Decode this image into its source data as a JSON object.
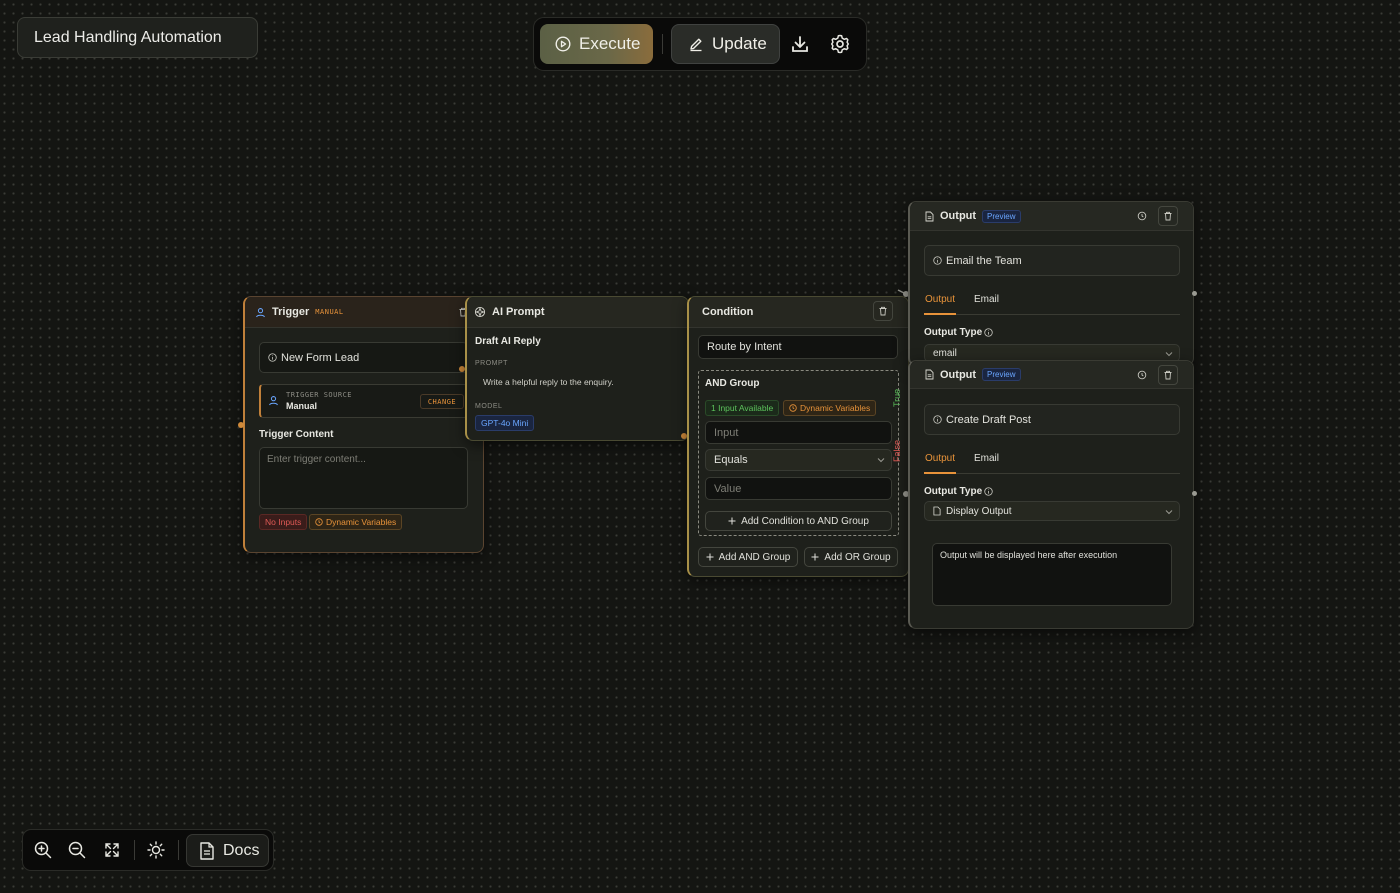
{
  "workflow": {
    "title": "Lead Handling Automation"
  },
  "toolbar": {
    "execute_label": "Execute",
    "update_label": "Update",
    "download_icon": "download-icon",
    "settings_icon": "gear-icon"
  },
  "trigger_node": {
    "title": "Trigger",
    "mode_badge": "MANUAL",
    "name": "New Form Lead",
    "source_label": "TRIGGER SOURCE",
    "source_value": "Manual",
    "change_label": "CHANGE",
    "content_label": "Trigger Content",
    "content_placeholder": "Enter trigger content...",
    "badge_inputs": "No Inputs",
    "badge_variables": "Dynamic Variables"
  },
  "ai_node": {
    "title": "AI Prompt",
    "name": "Draft AI Reply",
    "prompt_label": "PROMPT",
    "prompt_text": "Write a helpful reply to the enquiry.",
    "model_label": "MODEL",
    "model_value": "GPT-4o Mini"
  },
  "condition_node": {
    "title": "Condition",
    "name": "Route by Intent",
    "group_title": "AND Group",
    "badge_inputs": "1 Input Available",
    "badge_variables": "Dynamic Variables",
    "input_placeholder": "Input",
    "operator_value": "Equals",
    "value_placeholder": "Value",
    "add_condition_label": "Add Condition to AND Group",
    "add_and_label": "Add AND Group",
    "add_or_label": "Add OR Group",
    "true_label": "True",
    "false_label": "False"
  },
  "output_node_1": {
    "title": "Output",
    "preview_badge": "Preview",
    "name": "Email the Team",
    "tab_output": "Output",
    "tab_email": "Email",
    "type_label": "Output Type",
    "type_value": "email"
  },
  "output_node_2": {
    "title": "Output",
    "preview_badge": "Preview",
    "name": "Create Draft Post",
    "tab_output": "Output",
    "tab_email": "Email",
    "type_label": "Output Type",
    "type_value": "Display Output",
    "result_text": "Output will be displayed here after execution"
  },
  "bottom_bar": {
    "zoom_in_icon": "zoom-in-icon",
    "zoom_out_icon": "zoom-out-icon",
    "fit_icon": "fit-view-icon",
    "theme_icon": "sun-icon",
    "docs_label": "Docs"
  },
  "colors": {
    "accent": "#e8933a",
    "canvas": "#141512",
    "node": "#1e201b",
    "true": "#5cc35c",
    "false": "#e05a56",
    "preview": "#6aa6ff"
  }
}
